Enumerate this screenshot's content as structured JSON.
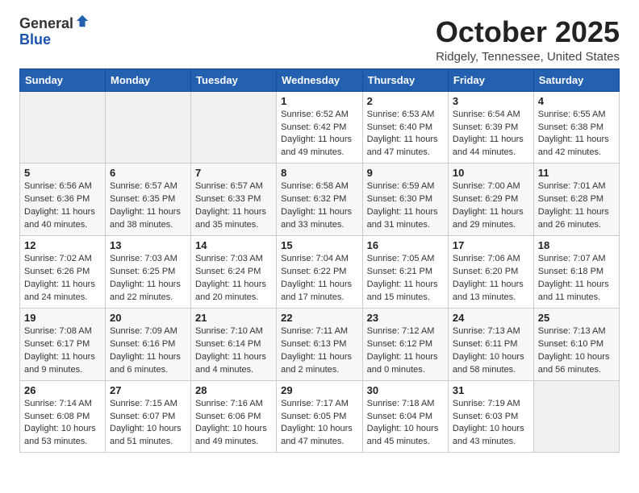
{
  "header": {
    "logo_general": "General",
    "logo_blue": "Blue",
    "month_title": "October 2025",
    "location": "Ridgely, Tennessee, United States"
  },
  "days_of_week": [
    "Sunday",
    "Monday",
    "Tuesday",
    "Wednesday",
    "Thursday",
    "Friday",
    "Saturday"
  ],
  "weeks": [
    [
      {
        "day": "",
        "info": ""
      },
      {
        "day": "",
        "info": ""
      },
      {
        "day": "",
        "info": ""
      },
      {
        "day": "1",
        "info": "Sunrise: 6:52 AM\nSunset: 6:42 PM\nDaylight: 11 hours\nand 49 minutes."
      },
      {
        "day": "2",
        "info": "Sunrise: 6:53 AM\nSunset: 6:40 PM\nDaylight: 11 hours\nand 47 minutes."
      },
      {
        "day": "3",
        "info": "Sunrise: 6:54 AM\nSunset: 6:39 PM\nDaylight: 11 hours\nand 44 minutes."
      },
      {
        "day": "4",
        "info": "Sunrise: 6:55 AM\nSunset: 6:38 PM\nDaylight: 11 hours\nand 42 minutes."
      }
    ],
    [
      {
        "day": "5",
        "info": "Sunrise: 6:56 AM\nSunset: 6:36 PM\nDaylight: 11 hours\nand 40 minutes."
      },
      {
        "day": "6",
        "info": "Sunrise: 6:57 AM\nSunset: 6:35 PM\nDaylight: 11 hours\nand 38 minutes."
      },
      {
        "day": "7",
        "info": "Sunrise: 6:57 AM\nSunset: 6:33 PM\nDaylight: 11 hours\nand 35 minutes."
      },
      {
        "day": "8",
        "info": "Sunrise: 6:58 AM\nSunset: 6:32 PM\nDaylight: 11 hours\nand 33 minutes."
      },
      {
        "day": "9",
        "info": "Sunrise: 6:59 AM\nSunset: 6:30 PM\nDaylight: 11 hours\nand 31 minutes."
      },
      {
        "day": "10",
        "info": "Sunrise: 7:00 AM\nSunset: 6:29 PM\nDaylight: 11 hours\nand 29 minutes."
      },
      {
        "day": "11",
        "info": "Sunrise: 7:01 AM\nSunset: 6:28 PM\nDaylight: 11 hours\nand 26 minutes."
      }
    ],
    [
      {
        "day": "12",
        "info": "Sunrise: 7:02 AM\nSunset: 6:26 PM\nDaylight: 11 hours\nand 24 minutes."
      },
      {
        "day": "13",
        "info": "Sunrise: 7:03 AM\nSunset: 6:25 PM\nDaylight: 11 hours\nand 22 minutes."
      },
      {
        "day": "14",
        "info": "Sunrise: 7:03 AM\nSunset: 6:24 PM\nDaylight: 11 hours\nand 20 minutes."
      },
      {
        "day": "15",
        "info": "Sunrise: 7:04 AM\nSunset: 6:22 PM\nDaylight: 11 hours\nand 17 minutes."
      },
      {
        "day": "16",
        "info": "Sunrise: 7:05 AM\nSunset: 6:21 PM\nDaylight: 11 hours\nand 15 minutes."
      },
      {
        "day": "17",
        "info": "Sunrise: 7:06 AM\nSunset: 6:20 PM\nDaylight: 11 hours\nand 13 minutes."
      },
      {
        "day": "18",
        "info": "Sunrise: 7:07 AM\nSunset: 6:18 PM\nDaylight: 11 hours\nand 11 minutes."
      }
    ],
    [
      {
        "day": "19",
        "info": "Sunrise: 7:08 AM\nSunset: 6:17 PM\nDaylight: 11 hours\nand 9 minutes."
      },
      {
        "day": "20",
        "info": "Sunrise: 7:09 AM\nSunset: 6:16 PM\nDaylight: 11 hours\nand 6 minutes."
      },
      {
        "day": "21",
        "info": "Sunrise: 7:10 AM\nSunset: 6:14 PM\nDaylight: 11 hours\nand 4 minutes."
      },
      {
        "day": "22",
        "info": "Sunrise: 7:11 AM\nSunset: 6:13 PM\nDaylight: 11 hours\nand 2 minutes."
      },
      {
        "day": "23",
        "info": "Sunrise: 7:12 AM\nSunset: 6:12 PM\nDaylight: 11 hours\nand 0 minutes."
      },
      {
        "day": "24",
        "info": "Sunrise: 7:13 AM\nSunset: 6:11 PM\nDaylight: 10 hours\nand 58 minutes."
      },
      {
        "day": "25",
        "info": "Sunrise: 7:13 AM\nSunset: 6:10 PM\nDaylight: 10 hours\nand 56 minutes."
      }
    ],
    [
      {
        "day": "26",
        "info": "Sunrise: 7:14 AM\nSunset: 6:08 PM\nDaylight: 10 hours\nand 53 minutes."
      },
      {
        "day": "27",
        "info": "Sunrise: 7:15 AM\nSunset: 6:07 PM\nDaylight: 10 hours\nand 51 minutes."
      },
      {
        "day": "28",
        "info": "Sunrise: 7:16 AM\nSunset: 6:06 PM\nDaylight: 10 hours\nand 49 minutes."
      },
      {
        "day": "29",
        "info": "Sunrise: 7:17 AM\nSunset: 6:05 PM\nDaylight: 10 hours\nand 47 minutes."
      },
      {
        "day": "30",
        "info": "Sunrise: 7:18 AM\nSunset: 6:04 PM\nDaylight: 10 hours\nand 45 minutes."
      },
      {
        "day": "31",
        "info": "Sunrise: 7:19 AM\nSunset: 6:03 PM\nDaylight: 10 hours\nand 43 minutes."
      },
      {
        "day": "",
        "info": ""
      }
    ]
  ]
}
